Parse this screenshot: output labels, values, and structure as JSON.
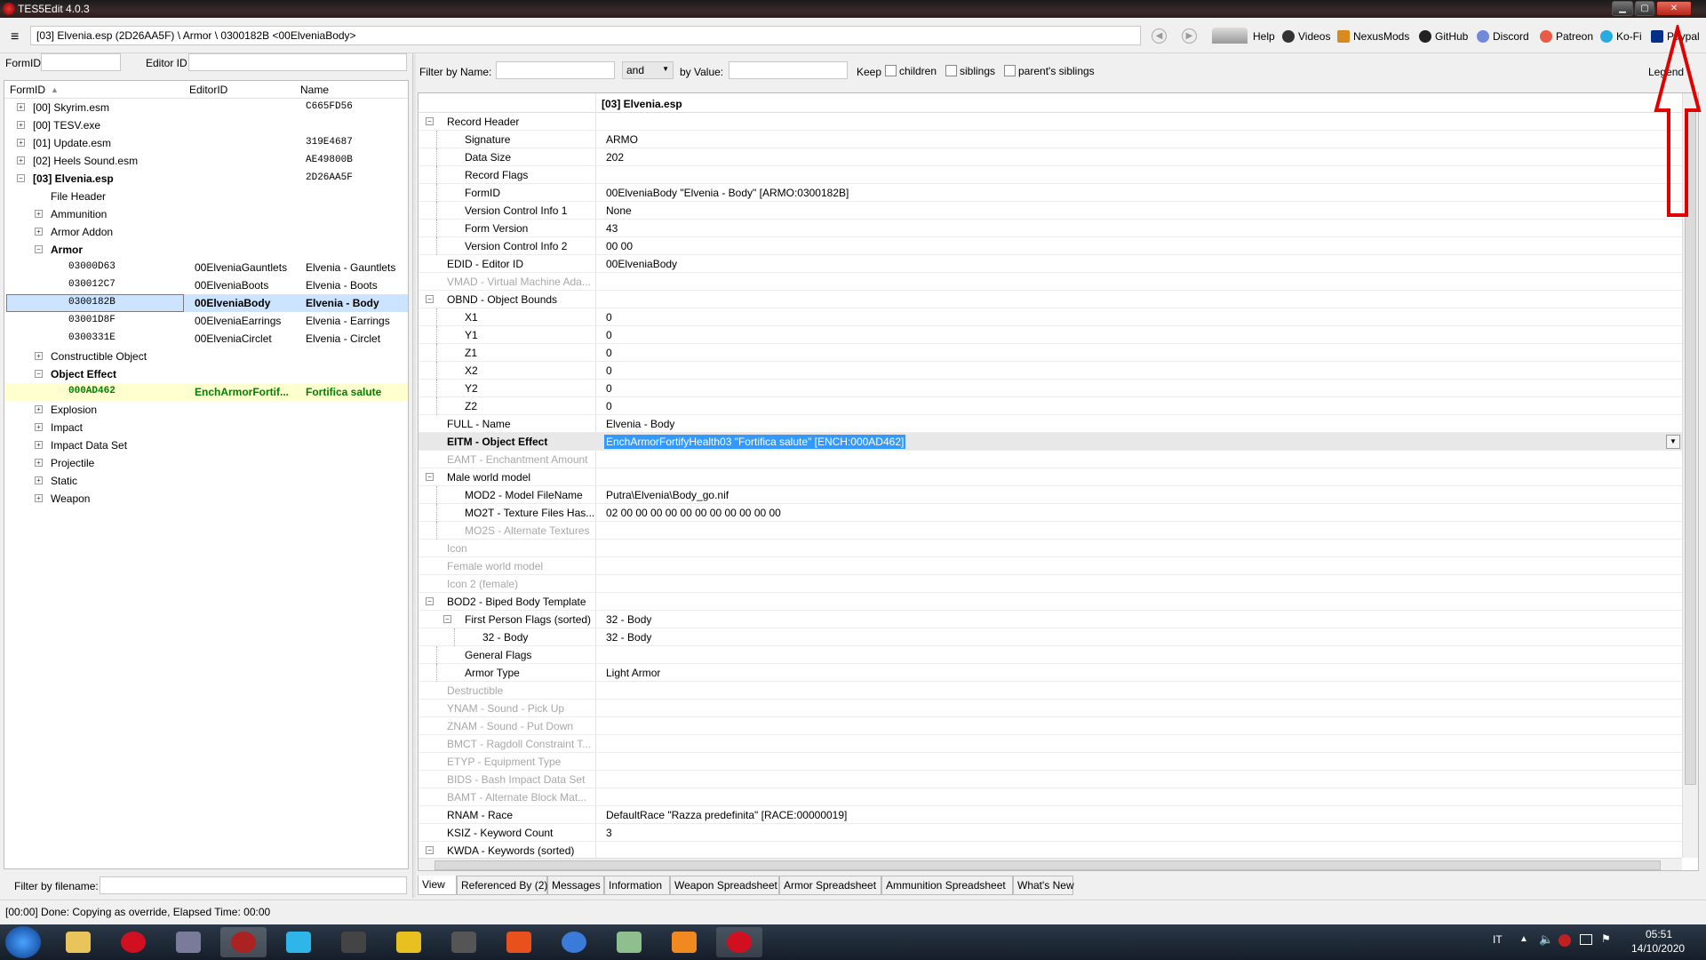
{
  "window": {
    "title": "TES5Edit 4.0.3"
  },
  "toolbar": {
    "path": "[03] Elvenia.esp (2D26AA5F) \\ Armor \\ 0300182B <00ElveniaBody>",
    "links": [
      "Help",
      "Videos",
      "NexusMods",
      "GitHub",
      "Discord",
      "Patreon",
      "Ko-Fi",
      "Paypal"
    ]
  },
  "left": {
    "formid_label": "FormID",
    "editorid_label": "Editor ID",
    "columns": [
      "FormID",
      "EditorID",
      "Name"
    ],
    "filter_label": "Filter by filename:",
    "rows": [
      {
        "formid": "[00] Skyrim.esm",
        "editorid": "",
        "name": "C665FD56"
      },
      {
        "formid": "[00] TESV.exe",
        "editorid": "",
        "name": ""
      },
      {
        "formid": "[01] Update.esm",
        "editorid": "",
        "name": "319E4687"
      },
      {
        "formid": "[02] Heels Sound.esm",
        "editorid": "",
        "name": "AE49800B"
      },
      {
        "formid": "[03] Elvenia.esp",
        "editorid": "",
        "name": "2D26AA5F"
      },
      {
        "formid": "File Header",
        "editorid": "",
        "name": ""
      },
      {
        "formid": "Ammunition",
        "editorid": "",
        "name": ""
      },
      {
        "formid": "Armor Addon",
        "editorid": "",
        "name": ""
      },
      {
        "formid": "Armor",
        "editorid": "",
        "name": ""
      },
      {
        "formid": "03000D63",
        "editorid": "00ElveniaGauntlets",
        "name": "Elvenia - Gauntlets"
      },
      {
        "formid": "030012C7",
        "editorid": "00ElveniaBoots",
        "name": "Elvenia - Boots"
      },
      {
        "formid": "0300182B",
        "editorid": "00ElveniaBody",
        "name": "Elvenia - Body"
      },
      {
        "formid": "03001D8F",
        "editorid": "00ElveniaEarrings",
        "name": "Elvenia - Earrings"
      },
      {
        "formid": "0300331E",
        "editorid": "00ElveniaCirclet",
        "name": "Elvenia - Circlet"
      },
      {
        "formid": "Constructible Object",
        "editorid": "",
        "name": ""
      },
      {
        "formid": "Object Effect",
        "editorid": "",
        "name": ""
      },
      {
        "formid": "000AD462",
        "editorid": "EnchArmorFortif...",
        "name": "Fortifica salute"
      },
      {
        "formid": "Explosion",
        "editorid": "",
        "name": ""
      },
      {
        "formid": "Impact",
        "editorid": "",
        "name": ""
      },
      {
        "formid": "Impact Data Set",
        "editorid": "",
        "name": ""
      },
      {
        "formid": "Projectile",
        "editorid": "",
        "name": ""
      },
      {
        "formid": "Static",
        "editorid": "",
        "name": ""
      },
      {
        "formid": "Weapon",
        "editorid": "",
        "name": ""
      }
    ]
  },
  "filterbar": {
    "by_name": "Filter by Name:",
    "op": "and",
    "by_value": "by Value:",
    "keep": "Keep",
    "children": "children",
    "siblings": "siblings",
    "parents": "parent's siblings",
    "legend": "Legend"
  },
  "grid": {
    "header": "[03] Elvenia.esp",
    "rows": [
      {
        "name": "Record Header",
        "value": ""
      },
      {
        "name": "Signature",
        "value": "ARMO"
      },
      {
        "name": "Data Size",
        "value": "202"
      },
      {
        "name": "Record Flags",
        "value": ""
      },
      {
        "name": "FormID",
        "value": "00ElveniaBody \"Elvenia - Body\" [ARMO:0300182B]"
      },
      {
        "name": "Version Control Info 1",
        "value": "None"
      },
      {
        "name": "Form Version",
        "value": "43"
      },
      {
        "name": "Version Control Info 2",
        "value": "00 00"
      },
      {
        "name": "EDID - Editor ID",
        "value": "00ElveniaBody"
      },
      {
        "name": "VMAD - Virtual Machine Ada...",
        "value": ""
      },
      {
        "name": "OBND - Object Bounds",
        "value": ""
      },
      {
        "name": "X1",
        "value": "0"
      },
      {
        "name": "Y1",
        "value": "0"
      },
      {
        "name": "Z1",
        "value": "0"
      },
      {
        "name": "X2",
        "value": "0"
      },
      {
        "name": "Y2",
        "value": "0"
      },
      {
        "name": "Z2",
        "value": "0"
      },
      {
        "name": "FULL - Name",
        "value": "Elvenia - Body"
      },
      {
        "name": "EITM - Object Effect",
        "value": "EnchArmorFortifyHealth03 \"Fortifica salute\" [ENCH:000AD462]"
      },
      {
        "name": "EAMT - Enchantment Amount",
        "value": ""
      },
      {
        "name": "Male world model",
        "value": ""
      },
      {
        "name": "MOD2 - Model FileName",
        "value": "Putra\\Elvenia\\Body_go.nif"
      },
      {
        "name": "MO2T - Texture Files Has...",
        "value": "02 00 00 00 00 00 00 00 00 00 00 00"
      },
      {
        "name": "MO2S - Alternate Textures",
        "value": ""
      },
      {
        "name": "Icon",
        "value": ""
      },
      {
        "name": "Female world model",
        "value": ""
      },
      {
        "name": "Icon 2 (female)",
        "value": ""
      },
      {
        "name": "BOD2 - Biped Body Template",
        "value": ""
      },
      {
        "name": "First Person Flags (sorted)",
        "value": "32 - Body"
      },
      {
        "name": "32 - Body",
        "value": "32 - Body"
      },
      {
        "name": "General Flags",
        "value": ""
      },
      {
        "name": "Armor Type",
        "value": "Light Armor"
      },
      {
        "name": "Destructible",
        "value": ""
      },
      {
        "name": "YNAM - Sound - Pick Up",
        "value": ""
      },
      {
        "name": "ZNAM - Sound - Put Down",
        "value": ""
      },
      {
        "name": "BMCT - Ragdoll Constraint T...",
        "value": ""
      },
      {
        "name": "ETYP - Equipment Type",
        "value": ""
      },
      {
        "name": "BIDS - Bash Impact Data Set",
        "value": ""
      },
      {
        "name": "BAMT - Alternate Block Mat...",
        "value": ""
      },
      {
        "name": "RNAM - Race",
        "value": "DefaultRace \"Razza predefinita\" [RACE:00000019]"
      },
      {
        "name": "KSIZ - Keyword Count",
        "value": "3"
      },
      {
        "name": "KWDA - Keywords (sorted)",
        "value": ""
      }
    ]
  },
  "tabs": [
    "View",
    "Referenced By (2)",
    "Messages",
    "Information",
    "Weapon Spreadsheet",
    "Armor Spreadsheet",
    "Ammunition Spreadsheet",
    "What's New"
  ],
  "status": "[00:00] Done: Copying as override, Elapsed Time: 00:00",
  "tray": {
    "lang": "IT",
    "time": "05:51",
    "date": "14/10/2020"
  },
  "colors": {
    "selection": "#cce4ff",
    "highlight_row": "#ffffd0",
    "override_green": "#008000",
    "arrow_red": "#e00000"
  }
}
